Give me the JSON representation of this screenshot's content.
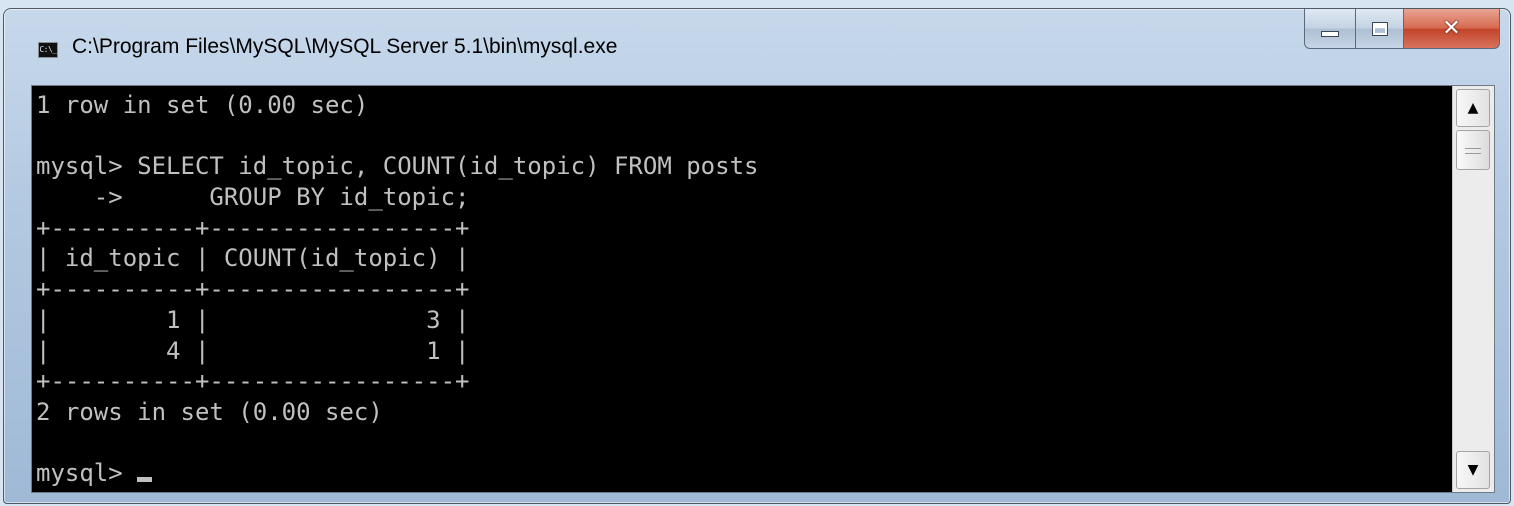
{
  "window": {
    "title": "C:\\Program Files\\MySQL\\MySQL Server 5.1\\bin\\mysql.exe",
    "icon_name": "console-app-icon",
    "icon_text": "C:\\_"
  },
  "caption_buttons": {
    "minimize_icon": "minimize-icon",
    "maximize_icon": "maximize-icon",
    "close_icon": "close-icon",
    "close_glyph": "✕"
  },
  "console": {
    "foreground": "#c0c0c0",
    "background": "#000000",
    "lines": [
      "1 row in set (0.00 sec)",
      "",
      "mysql> SELECT id_topic, COUNT(id_topic) FROM posts",
      "    ->      GROUP BY id_topic;",
      "+----------+-----------------+",
      "| id_topic | COUNT(id_topic) |",
      "+----------+-----------------+",
      "|        1 |               3 |",
      "|        4 |               1 |",
      "+----------+-----------------+",
      "2 rows in set (0.00 sec)",
      "",
      "mysql> "
    ]
  },
  "scrollbar": {
    "up_glyph": "▲",
    "down_glyph": "▼"
  }
}
